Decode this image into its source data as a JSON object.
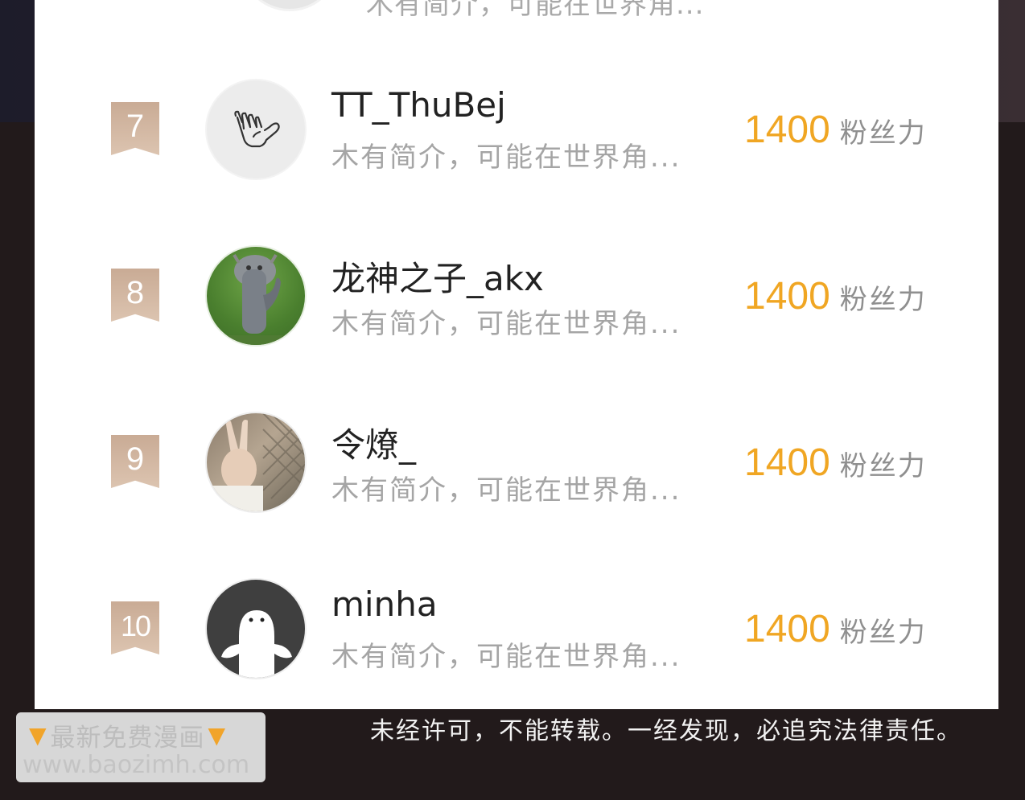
{
  "ghost_item": {
    "description": "木有简介，可能在世界角..."
  },
  "fans": [
    {
      "rank": "7",
      "name": "TT_ThuBej",
      "description": "木有简介，可能在世界角...",
      "score": "1400",
      "unit": "粉丝力",
      "avatar": "hand-sign-avatar"
    },
    {
      "rank": "8",
      "name": "龙神之子_akx",
      "description": "木有简介，可能在世界角...",
      "score": "1400",
      "unit": "粉丝力",
      "avatar": "dragon-statue-avatar"
    },
    {
      "rank": "9",
      "name": "令燎_",
      "description": "木有简介，可能在世界角...",
      "score": "1400",
      "unit": "粉丝力",
      "avatar": "peace-sign-avatar"
    },
    {
      "rank": "10",
      "name": "minha",
      "description": "木有简介，可能在世界角...",
      "score": "1400",
      "unit": "粉丝力",
      "avatar": "ghost-avatar"
    }
  ],
  "notice": "未经许可，不能转载。一经发现，必追究法律责任。",
  "watermark": {
    "line1": "最新免费漫画",
    "line2": "www.baozimh.com"
  },
  "colors": {
    "score": "#f0a623",
    "rank_badge": "#d2b8a3",
    "background": "#221a1b"
  }
}
